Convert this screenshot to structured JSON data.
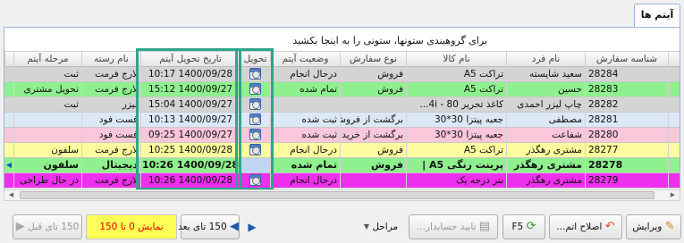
{
  "tab": {
    "label": "آیتم ها"
  },
  "group_hint": "برای گروهبندی ستونها، ستونی را به اینجا بکشید",
  "columns": {
    "order_id": "شناسه سفارش",
    "customer": "نام فرد",
    "item": "نام کالا",
    "order_type": "نوع سفارش",
    "status": "وضعیت آیتم",
    "delivery": "تحویل",
    "delivery_date": "تاریخ تحویل آیتم",
    "category": "نام رسته",
    "stage": "مرحله آیتم"
  },
  "rows": [
    {
      "order_id": "28284",
      "customer": "سعید شایسته",
      "item": "تراکت A5",
      "order_type": "فروش",
      "status": "درحال انجام",
      "date": "10:17 1400/09/28",
      "category": "لارج فرمت",
      "stage": "ثبت",
      "color": "#d4d4d4"
    },
    {
      "order_id": "28283",
      "customer": "حسین",
      "item": "تراکت A5",
      "order_type": "فروش",
      "status": "تمام شده",
      "date": "15:12 1400/09/27",
      "category": "لارج فرمت",
      "stage": "تحویل مشتری",
      "color": "#8ef08e"
    },
    {
      "order_id": "28282",
      "customer": "چاپ لیزر احمدی",
      "item": "کاغذ تحریر 4i - 80...",
      "order_type": "",
      "status": "",
      "date": "15:04 1400/09/27",
      "category": "لیزر",
      "stage": "ثبت",
      "color": "#d4d4d4"
    },
    {
      "order_id": "28281",
      "customer": "مصطفی",
      "item": "جعبه پیتزا 30*30",
      "order_type": "برگشت از فروش",
      "status": "ثبت شده",
      "date": "10:13 1400/09/27",
      "category": "فست فود",
      "stage": "",
      "color": "#dce8f6"
    },
    {
      "order_id": "28280",
      "customer": "شفاعت",
      "item": "جعبه پیتزا 30*30",
      "order_type": "برگشت از خرید",
      "status": "ثبت شده",
      "date": "09:25 1400/09/27",
      "category": "فست فود",
      "stage": "",
      "color": "#f9c6da"
    },
    {
      "order_id": "28277",
      "customer": "مشتری رهگذر",
      "item": "تراکت A5",
      "order_type": "فروش",
      "status": "درحال انجام",
      "date": "10:25 1400/09/28",
      "category": "لارج فرمت",
      "stage": "سلفون",
      "color": "#fcfc9e"
    },
    {
      "order_id": "28278",
      "customer": "مشتری رهگذر",
      "item": "پرینت رنگی A5 |",
      "order_type": "فروش",
      "status": "تمام شده",
      "date": "10:26 1400/09/28",
      "category": "دیجیتال",
      "stage": "سلفون",
      "color": "#8ef08e",
      "bold": true
    },
    {
      "order_id": "28279",
      "customer": "مشتری رهگذر",
      "item": "بنر درجه یک",
      "order_type": "",
      "status": "درحال انجام",
      "date": "10:26 1400/09/28",
      "category": "لارج فرمت",
      "stage": "در حال طراحی",
      "color": "#ee2fee"
    }
  ],
  "toolbar": {
    "edit": "ویرایش",
    "fix_item": "اصلاح اتم...",
    "f5": "F5",
    "accounting_confirm": "تایید حسابدار...",
    "stages": "مراحل",
    "next": "150 تای بعد",
    "display_range": "نمایش 0 تا 150",
    "previous": "150 تای قبل"
  },
  "colors": {
    "highlight_box": "#2fa58c",
    "selected_row": "#8ef08e",
    "info_box_bg": "#ffff55",
    "info_box_text": "#e00000"
  }
}
